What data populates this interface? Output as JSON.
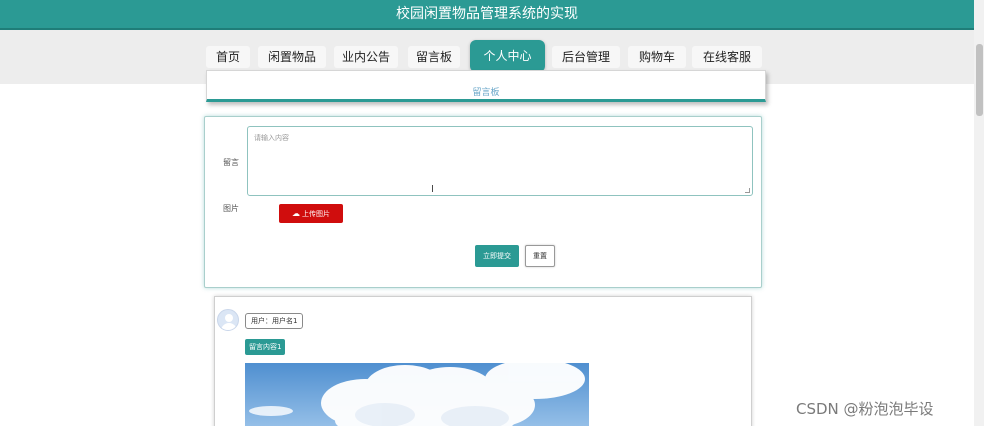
{
  "app": {
    "title": "校园闲置物品管理系统的实现"
  },
  "nav": {
    "items": [
      {
        "label": "首页"
      },
      {
        "label": "闲置物品"
      },
      {
        "label": "业内公告"
      },
      {
        "label": "留言板"
      },
      {
        "label": "个人中心"
      },
      {
        "label": "后台管理"
      },
      {
        "label": "购物车"
      },
      {
        "label": "在线客服"
      }
    ],
    "active": "个人中心"
  },
  "section": {
    "title": "留言板"
  },
  "form": {
    "message_label": "留言",
    "message_placeholder": "请输入内容",
    "image_label": "图片",
    "upload_label": "上传图片",
    "submit_label": "立即提交",
    "reset_label": "重置"
  },
  "message": {
    "user_text": "用户：用户名1",
    "content_text": "留言内容1"
  },
  "watermark": "CSDN @粉泡泡毕设",
  "colors": {
    "primary": "#2b9a94",
    "danger": "#d00d0d"
  }
}
